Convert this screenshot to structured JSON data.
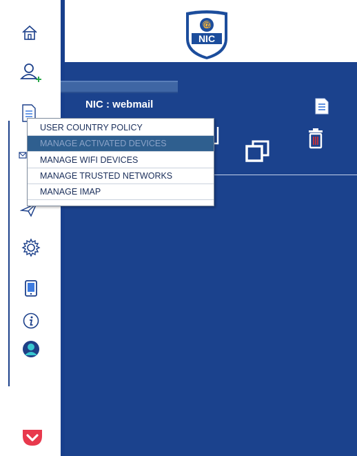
{
  "app": {
    "title": "NIC : webmail"
  },
  "logo": {
    "symbol": "@",
    "text": "NIC"
  },
  "sidebar": {
    "items": [
      {
        "icon": "home-icon"
      },
      {
        "icon": "add-user-icon"
      },
      {
        "icon": "document-icon"
      },
      {
        "icon": "mail-icon"
      },
      {
        "icon": "send-icon"
      },
      {
        "icon": "settings-icon"
      },
      {
        "icon": "mobile-device-icon"
      },
      {
        "icon": "info-icon"
      },
      {
        "icon": "user-profile-icon"
      },
      {
        "icon": "pocket-icon"
      }
    ]
  },
  "dropdown_menu": {
    "items": [
      {
        "label": "USER COUNTRY POLICY",
        "active": false
      },
      {
        "label": "MANAGE ACTIVATED DEVICES",
        "active": true
      },
      {
        "label": "MANAGE WIFI DEVICES",
        "active": false
      },
      {
        "label": "MANAGE TRUSTED NETWORKS",
        "active": false
      },
      {
        "label": "MANAGE IMAP",
        "active": false
      }
    ]
  },
  "toolbar": {
    "icons": [
      "document-icon",
      "restore-window-icon",
      "trash-icon"
    ]
  },
  "colors": {
    "panel": "#1b428d",
    "active_menu": "#2f5f8f",
    "pocket_red": "#e8394d"
  }
}
